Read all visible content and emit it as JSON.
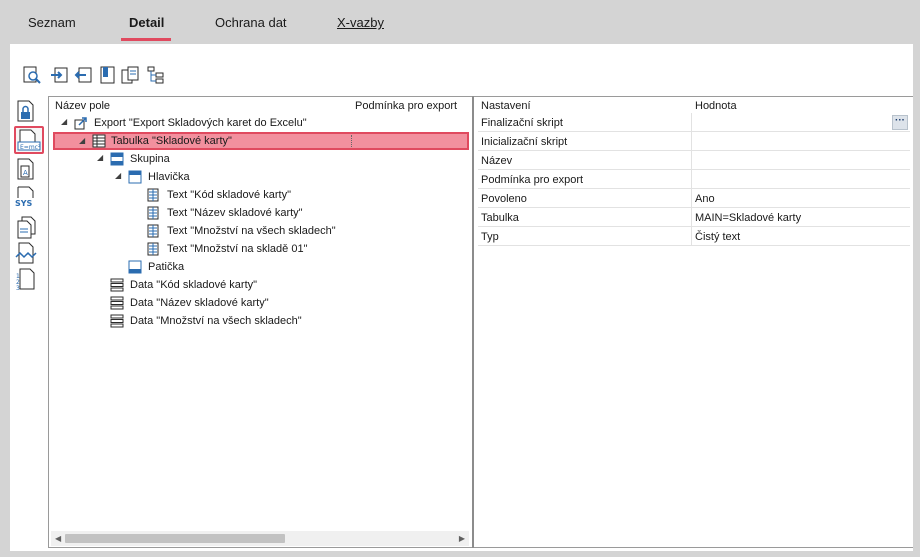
{
  "tabs": [
    {
      "label": "Seznam"
    },
    {
      "label": "Detail"
    },
    {
      "label": "Ochrana dat"
    },
    {
      "label": "X-vazby"
    }
  ],
  "toolbar": {
    "icons": [
      "preview-icon",
      "import-icon",
      "export-icon",
      "bookmark-icon",
      "copy-icon",
      "tree-structure-icon"
    ]
  },
  "left_bar": {
    "icons": [
      "lock-document-icon",
      "formula-document-icon",
      "variable-document-icon",
      "sys-icon",
      "duplicate-document-icon",
      "wave-document-icon",
      "numbered-document-icon"
    ]
  },
  "tree": {
    "col_name": "Název pole",
    "col_condition": "Podmínka pro export",
    "rows": [
      {
        "label": "Export \"Export Skladových karet do Excelu\"",
        "icon": "export-arrow-icon"
      },
      {
        "label": "Tabulka \"Skladové karty\"",
        "icon": "table-icon"
      },
      {
        "label": "Skupina",
        "icon": "group-icon"
      },
      {
        "label": "Hlavička",
        "icon": "header-icon"
      },
      {
        "label": "Text \"Kód skladové karty\"",
        "icon": "text-field-icon"
      },
      {
        "label": "Text \"Název skladové karty\"",
        "icon": "text-field-icon"
      },
      {
        "label": "Text \"Množství na všech skladech\"",
        "icon": "text-field-icon"
      },
      {
        "label": "Text \"Množství na skladě 01\"",
        "icon": "text-field-icon"
      },
      {
        "label": "Patička",
        "icon": "footer-icon"
      },
      {
        "label": "Data \"Kód skladové karty\"",
        "icon": "data-icon"
      },
      {
        "label": "Data \"Název skladové karty\"",
        "icon": "data-icon"
      },
      {
        "label": "Data \"Množství na všech skladech\"",
        "icon": "data-icon"
      }
    ]
  },
  "grid": {
    "col_setting": "Nastavení",
    "col_value": "Hodnota",
    "more_label": "···",
    "rows": [
      {
        "setting": "Finalizační skript",
        "value": ""
      },
      {
        "setting": "Inicializační skript",
        "value": ""
      },
      {
        "setting": "Název",
        "value": ""
      },
      {
        "setting": "Podmínka pro export",
        "value": ""
      },
      {
        "setting": "Povoleno",
        "value": "Ano"
      },
      {
        "setting": "Tabulka",
        "value": "MAIN=Skladové karty"
      },
      {
        "setting": "Typ",
        "value": "Čistý text"
      }
    ]
  },
  "colors": {
    "accent": "#e04a5f",
    "selection": "#f2909e",
    "icon_blue": "#2b6cb0"
  }
}
